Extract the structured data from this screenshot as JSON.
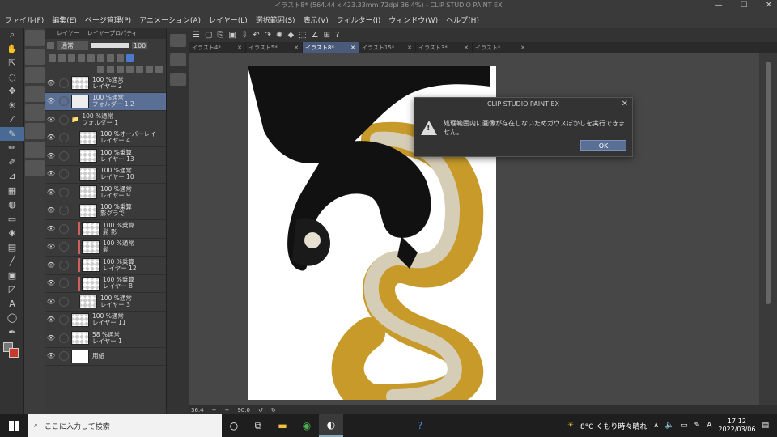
{
  "window": {
    "title": "イラスト8* (564.44 x 423.33mm 72dpi 36.4%) - CLIP STUDIO PAINT EX",
    "minimize": "—",
    "maximize": "☐",
    "close": "✕"
  },
  "menu": [
    "ファイル(F)",
    "編集(E)",
    "ページ管理(P)",
    "アニメーション(A)",
    "レイヤー(L)",
    "選択範囲(S)",
    "表示(V)",
    "フィルター(I)",
    "ウィンドウ(W)",
    "ヘルプ(H)"
  ],
  "layer_panel": {
    "tabs": [
      "レイヤー",
      "レイヤープロパティ"
    ],
    "blend_mode": "通常",
    "opacity": "100",
    "layers": [
      {
        "pct": "100 %通常",
        "name": "レイヤー 2",
        "thumb": "checker",
        "selected": false,
        "red": false
      },
      {
        "pct": "100 %通常",
        "name": "フォルダー 1 2",
        "thumb": "folder",
        "selected": true,
        "red": false
      },
      {
        "pct": "100 %通常",
        "name": "フォルダー 1",
        "thumb": "none",
        "selected": false,
        "red": false
      },
      {
        "pct": "100 %オーバーレイ",
        "name": "レイヤー 4",
        "thumb": "checker",
        "selected": false,
        "red": false
      },
      {
        "pct": "100 %乗算",
        "name": "レイヤー 13",
        "thumb": "checker",
        "selected": false,
        "red": false
      },
      {
        "pct": "100 %通常",
        "name": "レイヤー 10",
        "thumb": "checker",
        "selected": false,
        "red": false
      },
      {
        "pct": "100 %通常",
        "name": "レイヤー 9",
        "thumb": "checker",
        "selected": false,
        "red": false
      },
      {
        "pct": "100 %乗算",
        "name": "影グラで",
        "thumb": "checker",
        "selected": false,
        "red": false
      },
      {
        "pct": "100 %乗算",
        "name": "髭 影",
        "thumb": "checker",
        "selected": false,
        "red": true
      },
      {
        "pct": "100 %通常",
        "name": "髭",
        "thumb": "checker",
        "selected": false,
        "red": true
      },
      {
        "pct": "100 %乗算",
        "name": "レイヤー 12",
        "thumb": "checker",
        "selected": false,
        "red": true
      },
      {
        "pct": "100 %乗算",
        "name": "レイヤー 8",
        "thumb": "checker",
        "selected": false,
        "red": true
      },
      {
        "pct": "100 %通常",
        "name": "レイヤー 3",
        "thumb": "checker",
        "selected": false,
        "red": false
      },
      {
        "pct": "100 %通常",
        "name": "レイヤー 11",
        "thumb": "checker",
        "selected": false,
        "red": false
      },
      {
        "pct": "58 %通常",
        "name": "レイヤー 1",
        "thumb": "checker",
        "selected": false,
        "red": false
      },
      {
        "pct": "",
        "name": "用紙",
        "thumb": "white",
        "selected": false,
        "red": false
      }
    ]
  },
  "canvas_tabs": [
    "イラスト4*",
    "イラスト5*",
    "イラスト8*",
    "イラスト15*",
    "イラスト3*",
    "イラスト*"
  ],
  "active_tab_index": 2,
  "status": {
    "zoom": "36.4",
    "angle": "90.0"
  },
  "dialog": {
    "title": "CLIP STUDIO PAINT EX",
    "message": "処理範囲内に画像が存在しないためガウスぼかしを実行できません。",
    "ok": "OK"
  },
  "taskbar": {
    "search_placeholder": "ここに入力して検索",
    "weather": "8°C くもり時々晴れ",
    "ime": "A",
    "time": "17:12",
    "date": "2022/03/06"
  }
}
